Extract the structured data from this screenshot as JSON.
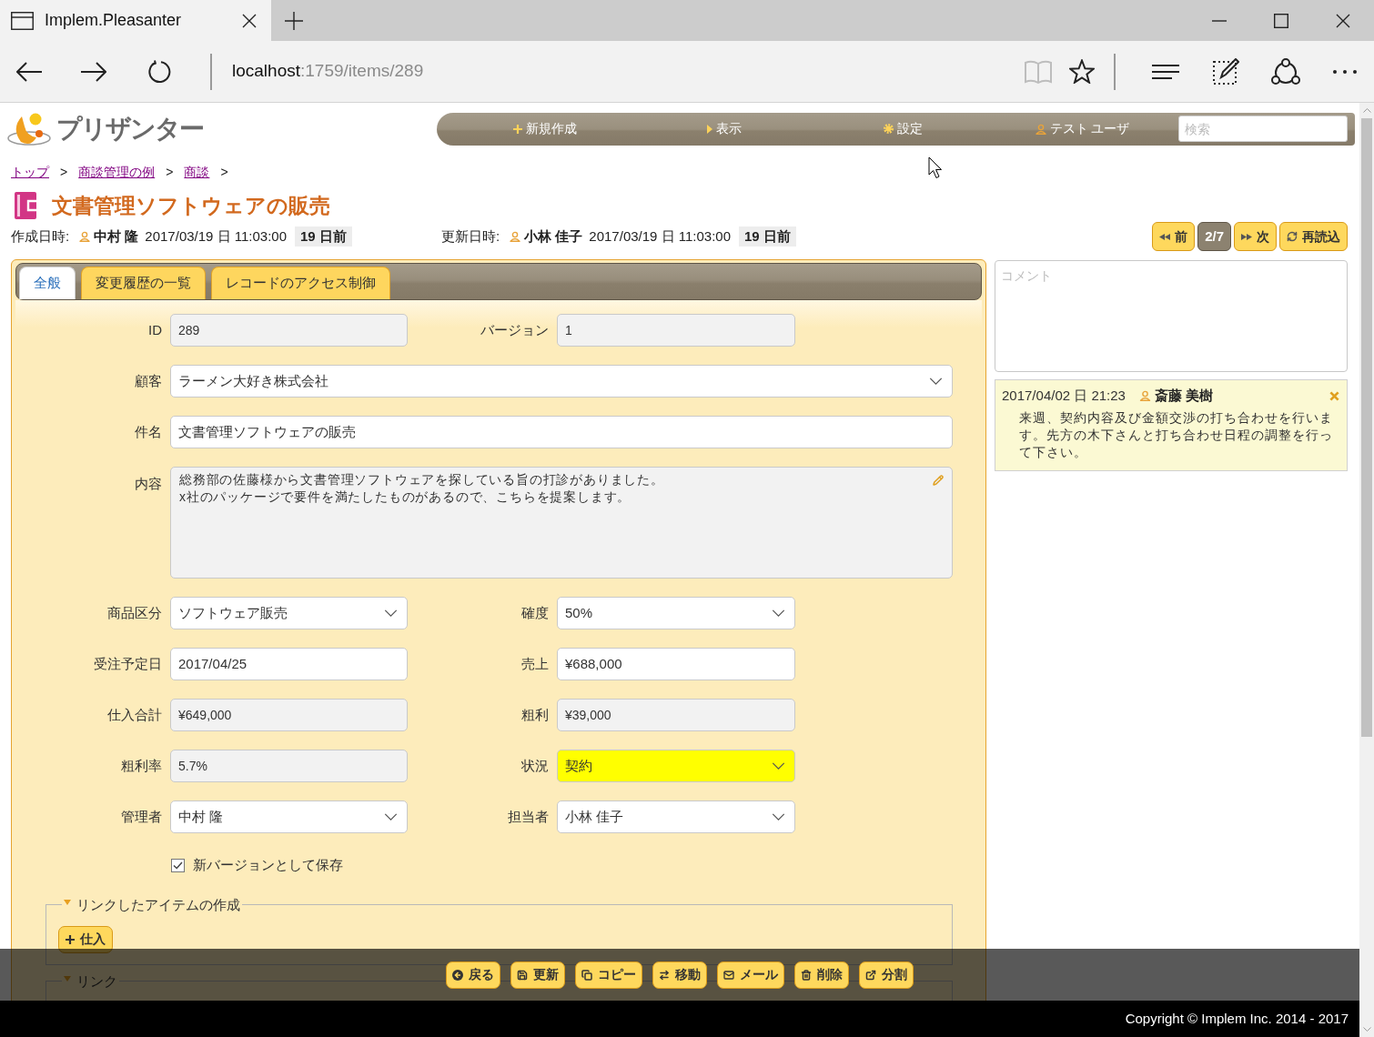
{
  "browser": {
    "tab_title": "Implem.Pleasanter",
    "url_host": "localhost",
    "url_rest": ":1759/items/289"
  },
  "header": {
    "logo_text": "プリザンター",
    "menu": [
      {
        "kind": "new",
        "label": "新規作成"
      },
      {
        "kind": "view",
        "label": "表示"
      },
      {
        "kind": "settings",
        "label": "設定"
      },
      {
        "kind": "user",
        "label": "テスト ユーザ"
      }
    ],
    "search": {
      "placeholder": "検索"
    }
  },
  "breadcrumb": [
    {
      "label": "トップ",
      "separator": ">"
    },
    {
      "label": "商談管理の例",
      "separator": ">"
    },
    {
      "label": "商談",
      "separator": ">"
    }
  ],
  "title": "文書管理ソフトウェアの販売",
  "record_info": [
    {
      "label": "作成日時:",
      "user": "中村 隆",
      "datetime": "2017/03/19 日 11:03:00",
      "elapsed": "19 日前"
    },
    {
      "label": "更新日時:",
      "user": "小林 佳子",
      "datetime": "2017/03/19 日 11:03:00",
      "elapsed": "19 日前"
    }
  ],
  "record_nav": [
    {
      "kind": "prev",
      "label": "前"
    },
    {
      "kind": "counter",
      "label": "2/7"
    },
    {
      "kind": "next",
      "label": "次"
    },
    {
      "kind": "reload",
      "label": "再読込"
    }
  ],
  "tabs": [
    {
      "label": "全般",
      "selected": true
    },
    {
      "label": "変更履歴の一覧",
      "selected": false
    },
    {
      "label": "レコードのアクセス制御",
      "selected": false
    }
  ],
  "form": {
    "rows": [
      {
        "fields": [
          {
            "label": "ID",
            "kind": "readonly",
            "value": "289"
          },
          {
            "label": "バージョン",
            "kind": "readonly",
            "value": "1"
          }
        ]
      },
      {
        "fields": [
          {
            "label": "顧客",
            "kind": "select",
            "value": "ラーメン大好き株式会社"
          }
        ]
      },
      {
        "fields": [
          {
            "label": "件名",
            "kind": "input",
            "value": "文書管理ソフトウェアの販売"
          }
        ]
      },
      {
        "fields": [
          {
            "label": "内容",
            "kind": "textarea",
            "value": "総務部の佐藤様から文書管理ソフトウェアを探している旨の打診がありました。\nx社のパッケージで要件を満たしたものがあるので、こちらを提案します。"
          }
        ]
      },
      {
        "fields": [
          {
            "label": "商品区分",
            "kind": "select",
            "value": "ソフトウェア販売"
          },
          {
            "label": "確度",
            "kind": "select",
            "value": "50%"
          }
        ]
      },
      {
        "fields": [
          {
            "label": "受注予定日",
            "kind": "input",
            "value": "2017/04/25"
          },
          {
            "label": "売上",
            "kind": "input",
            "value": "¥688,000"
          }
        ]
      },
      {
        "fields": [
          {
            "label": "仕入合計",
            "kind": "readonly",
            "value": "¥649,000"
          },
          {
            "label": "粗利",
            "kind": "readonly",
            "value": "¥39,000"
          }
        ]
      },
      {
        "fields": [
          {
            "label": "粗利率",
            "kind": "readonly",
            "value": "5.7%"
          },
          {
            "label": "状況",
            "kind": "select",
            "value": "契約",
            "color": "#ffff00"
          }
        ]
      },
      {
        "fields": [
          {
            "label": "管理者",
            "kind": "select",
            "value": "中村 隆"
          },
          {
            "label": "担当者",
            "kind": "select",
            "value": "小林 佳子"
          }
        ]
      }
    ],
    "save_option": {
      "label": "新バージョンとして保存",
      "checked": true
    }
  },
  "link_sections": [
    {
      "title": "リンクしたアイテムの作成",
      "expanded": true,
      "buttons": [
        {
          "label": "仕入"
        }
      ]
    },
    {
      "title": "リンク",
      "expanded": true
    }
  ],
  "comment_box": {
    "placeholder": "コメント"
  },
  "comments": [
    {
      "datetime": "2017/04/02 日 21:23",
      "user": "斎藤 美樹",
      "text": "来週、契約内容及び金額交渉の打ち合わせを行います。先方の木下さんと打ち合わせ日程の調整を行って下さい。"
    }
  ],
  "commands": [
    {
      "kind": "back",
      "label": "戻る"
    },
    {
      "kind": "update",
      "label": "更新"
    },
    {
      "kind": "copy",
      "label": "コピー"
    },
    {
      "kind": "move",
      "label": "移動"
    },
    {
      "kind": "mail",
      "label": "メール"
    },
    {
      "kind": "delete",
      "label": "削除"
    },
    {
      "kind": "split",
      "label": "分割"
    }
  ],
  "footer": "Copyright © Implem Inc. 2014 - 2017"
}
